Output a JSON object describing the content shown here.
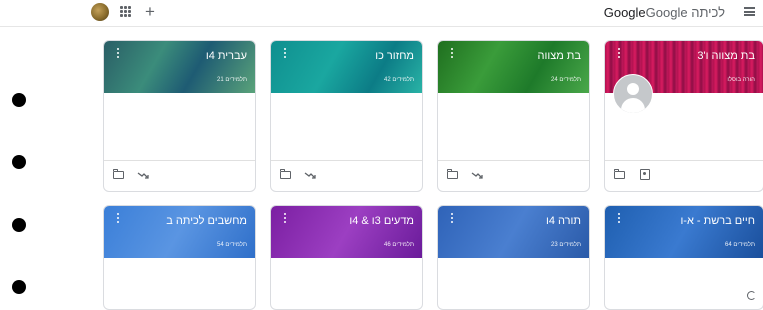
{
  "header": {
    "brand_google_1": "Google",
    "brand_google_2": "Google",
    "brand_suffix": "לכיתה",
    "plus": "+"
  },
  "classes": [
    {
      "title": "עברית 4ו",
      "subtitle": "21 תלמידים",
      "color": "#2f7c6e"
    },
    {
      "title": "מחזור כו",
      "subtitle": "42 תלמידים",
      "color": "#119a9a"
    },
    {
      "title": "בת מצווה",
      "subtitle": "24 תלמידים",
      "color": "#2e8b2e"
    },
    {
      "title": "בת מצווה ו'3",
      "subtitle": "הורה בוסלו",
      "color": "#c2185b"
    },
    {
      "title": "מחשבים לכיתה ב",
      "subtitle": "54 תלמידים",
      "color": "#3d7ed9"
    },
    {
      "title": "מדעים 3ו & 4ו",
      "subtitle": "46 תלמידים",
      "color": "#8e24aa"
    },
    {
      "title": "תורה 4ו",
      "subtitle": "23 תלמידים",
      "color": "#3e6fc4"
    },
    {
      "title": "חיים ברשת - א-ו",
      "subtitle": "64 תלמידים",
      "color": "#2b6fc5"
    }
  ]
}
